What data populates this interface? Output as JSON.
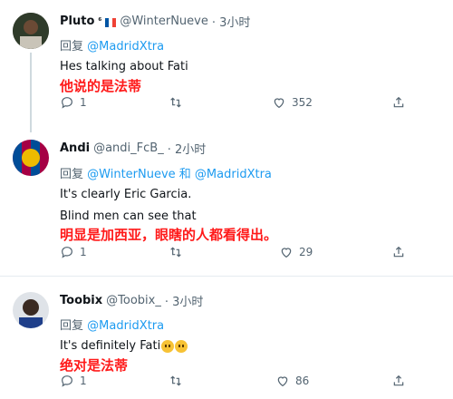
{
  "tweets": [
    {
      "name": "Pluto",
      "name_suffix": "⁶",
      "handle": "@WinterNueve",
      "time": "· 3小时",
      "reply_prefix": "回复",
      "reply_to": "@MadridXtra",
      "text_lines": [
        "Hes talking about Fati"
      ],
      "translation": "他说的是法蒂",
      "reply_count": "1",
      "retweet_count": "",
      "like_count": "352"
    },
    {
      "name": "Andi",
      "handle": "@andi_FcB_",
      "time": "· 2小时",
      "reply_prefix": "回复",
      "reply_to": "@WinterNueve 和 @MadridXtra",
      "text_lines": [
        "It's clearly Eric Garcia.",
        "Blind men can see that"
      ],
      "translation": "明显是加西亚，眼瞎的人都看得出。",
      "reply_count": "1",
      "retweet_count": "",
      "like_count": "29"
    },
    {
      "name": "Toobix",
      "handle": "@Toobix_",
      "time": "· 3小时",
      "reply_prefix": "回复",
      "reply_to": "@MadridXtra",
      "text_lines": [
        "It's definitely Fati"
      ],
      "translation": "绝对是法蒂",
      "reply_count": "1",
      "retweet_count": "",
      "like_count": "86"
    }
  ],
  "colors": {
    "accent": "#1d9bf0",
    "muted": "#536471",
    "translation": "#ff1a1a"
  },
  "icons": [
    "reply-icon",
    "retweet-icon",
    "like-icon",
    "share-icon",
    "crying-emoji-icon",
    "france-flag-icon"
  ]
}
